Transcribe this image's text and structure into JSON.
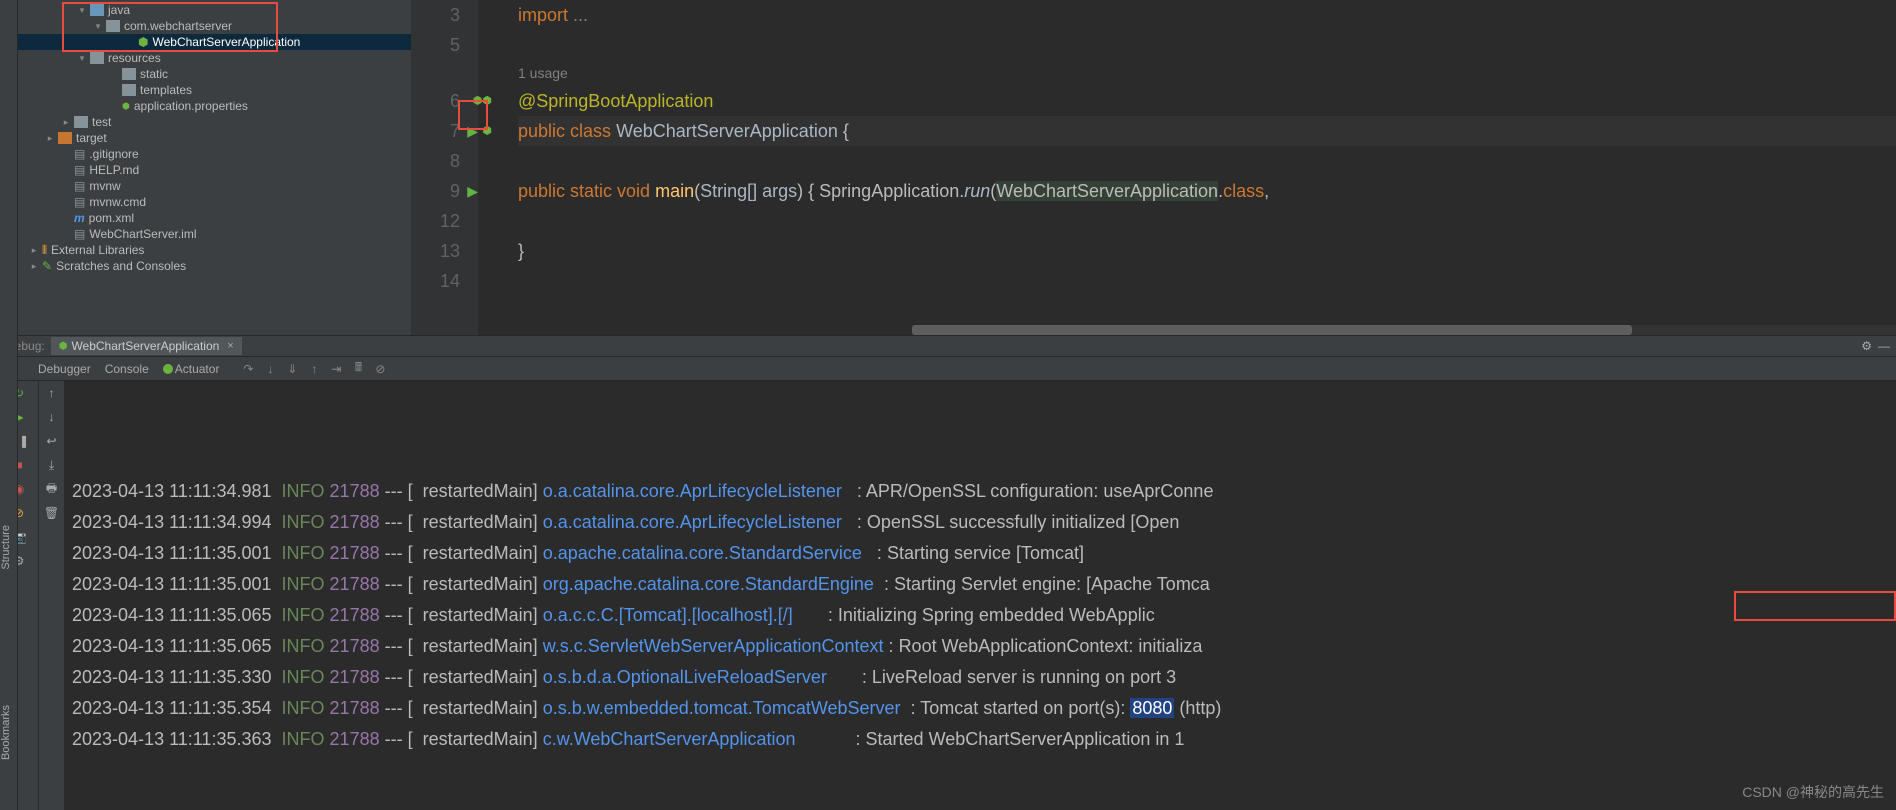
{
  "watermark": "CSDN @神秘的高先生",
  "sidebar": {
    "structure": "Structure",
    "bookmarks": "Bookmarks"
  },
  "tree": {
    "items": [
      {
        "indent": 52,
        "arrow": "▾",
        "icon": "folder-blue",
        "label": "java"
      },
      {
        "indent": 68,
        "arrow": "▾",
        "icon": "folder-grey",
        "label": "com.webchartserver",
        "boxed": true
      },
      {
        "indent": 100,
        "arrow": "",
        "icon": "spring",
        "label": "WebChartServerApplication",
        "selected": true,
        "boxed": true
      },
      {
        "indent": 52,
        "arrow": "▾",
        "icon": "folder-grey",
        "label": "resources"
      },
      {
        "indent": 84,
        "arrow": "",
        "icon": "folder-grey",
        "label": "static"
      },
      {
        "indent": 84,
        "arrow": "",
        "icon": "folder-grey",
        "label": "templates"
      },
      {
        "indent": 84,
        "arrow": "",
        "icon": "leaf",
        "label": "application.properties"
      },
      {
        "indent": 36,
        "arrow": "▸",
        "icon": "folder-grey",
        "label": "test"
      },
      {
        "indent": 20,
        "arrow": "▸",
        "icon": "folder-orange",
        "label": "target"
      },
      {
        "indent": 36,
        "arrow": "",
        "icon": "file",
        "label": ".gitignore"
      },
      {
        "indent": 36,
        "arrow": "",
        "icon": "file",
        "label": "HELP.md"
      },
      {
        "indent": 36,
        "arrow": "",
        "icon": "file",
        "label": "mvnw"
      },
      {
        "indent": 36,
        "arrow": "",
        "icon": "file",
        "label": "mvnw.cmd"
      },
      {
        "indent": 36,
        "arrow": "",
        "icon": "maven",
        "label": "pom.xml"
      },
      {
        "indent": 36,
        "arrow": "",
        "icon": "file",
        "label": "WebChartServer.iml"
      },
      {
        "indent": 4,
        "arrow": "▸",
        "icon": "lib",
        "label": "External Libraries"
      },
      {
        "indent": 4,
        "arrow": "▸",
        "icon": "scratch",
        "label": "Scratches and Consoles"
      }
    ]
  },
  "editor": {
    "usages": "1 usage",
    "lines": [
      {
        "n": "3",
        "content_html": "<span class='c-keyword'>import</span> <span class='c-grey'>...</span>"
      },
      {
        "n": "5",
        "content_html": ""
      },
      {
        "n": "",
        "content_html": "<span class='c-grey'>1 usage</span>",
        "usage": true
      },
      {
        "n": "6",
        "content_html": "<span class='c-anno'>@SpringBootApplication</span>",
        "icons": "leaf"
      },
      {
        "n": "7",
        "content_html": "<span class='c-keyword'>public class</span> <span class='c-class'>WebChartServerApplication</span> {",
        "icons": "run",
        "hl": true
      },
      {
        "n": "8",
        "content_html": ""
      },
      {
        "n": "9",
        "content_html": "    <span class='c-keyword'>public static void</span> <span class='c-method'>main</span>(<span class='c-param'>String[] args</span>) {  SpringApplication.<span class='c-static'>run</span>(<span class='c-hl'>WebChartServerApplication</span>.<span class='c-keyword'>class</span>,",
        "icons": "run2"
      },
      {
        "n": "12",
        "content_html": ""
      },
      {
        "n": "13",
        "content_html": "}"
      },
      {
        "n": "14",
        "content_html": ""
      }
    ]
  },
  "debug": {
    "label": "Debug:",
    "tab": "WebChartServerApplication",
    "tabs": [
      "Debugger",
      "Console",
      "Actuator"
    ]
  },
  "console": {
    "lines": [
      {
        "ts": "2023-04-13 11:11:34.981",
        "lvl": "INFO",
        "pid": "21788",
        "thr": "restartedMain",
        "logger": "o.a.catalina.core.AprLifecycleListener",
        "msg": "APR/OpenSSL configuration: useAprConne"
      },
      {
        "ts": "2023-04-13 11:11:34.994",
        "lvl": "INFO",
        "pid": "21788",
        "thr": "restartedMain",
        "logger": "o.a.catalina.core.AprLifecycleListener",
        "msg": "OpenSSL successfully initialized [Open"
      },
      {
        "ts": "2023-04-13 11:11:35.001",
        "lvl": "INFO",
        "pid": "21788",
        "thr": "restartedMain",
        "logger": "o.apache.catalina.core.StandardService",
        "msg": "Starting service [Tomcat]"
      },
      {
        "ts": "2023-04-13 11:11:35.001",
        "lvl": "INFO",
        "pid": "21788",
        "thr": "restartedMain",
        "logger": "org.apache.catalina.core.StandardEngine",
        "msg": "Starting Servlet engine: [Apache Tomca"
      },
      {
        "ts": "2023-04-13 11:11:35.065",
        "lvl": "INFO",
        "pid": "21788",
        "thr": "restartedMain",
        "logger": "o.a.c.c.C.[Tomcat].[localhost].[/]",
        "msg": "Initializing Spring embedded WebApplic"
      },
      {
        "ts": "2023-04-13 11:11:35.065",
        "lvl": "INFO",
        "pid": "21788",
        "thr": "restartedMain",
        "logger": "w.s.c.ServletWebServerApplicationContext",
        "msg": "Root WebApplicationContext: initializa"
      },
      {
        "ts": "2023-04-13 11:11:35.330",
        "lvl": "INFO",
        "pid": "21788",
        "thr": "restartedMain",
        "logger": "o.s.b.d.a.OptionalLiveReloadServer",
        "msg": "LiveReload server is running on port 3"
      },
      {
        "ts": "2023-04-13 11:11:35.354",
        "lvl": "INFO",
        "pid": "21788",
        "thr": "restartedMain",
        "logger": "o.s.b.w.embedded.tomcat.TomcatWebServer",
        "msg": "Tomcat started on port(s): ",
        "port": "8080",
        "msg2": " (http)"
      },
      {
        "ts": "2023-04-13 11:11:35.363",
        "lvl": "INFO",
        "pid": "21788",
        "thr": "restartedMain",
        "logger": "c.w.WebChartServerApplication",
        "msg": "Started WebChartServerApplication in 1"
      }
    ]
  }
}
